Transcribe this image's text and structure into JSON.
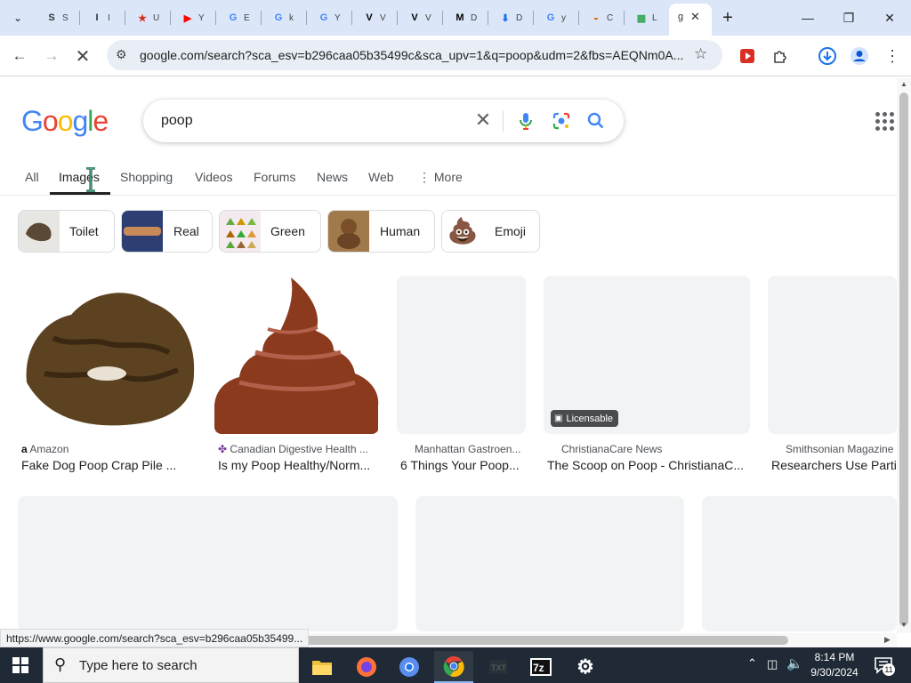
{
  "browser": {
    "tabs": [
      {
        "icon": "S",
        "title": "S",
        "color": "#333333"
      },
      {
        "icon": "I",
        "title": "I",
        "color": "#333333"
      },
      {
        "icon": "★",
        "title": "U",
        "color": "#d93025"
      },
      {
        "icon": "▶",
        "title": "Y",
        "color": "#ff0000"
      },
      {
        "icon": "G",
        "title": "E",
        "color": "#4285f4"
      },
      {
        "icon": "G",
        "title": "k",
        "color": "#4285f4"
      },
      {
        "icon": "G",
        "title": "Y",
        "color": "#4285f4"
      },
      {
        "icon": "V",
        "title": "V",
        "color": "#000000"
      },
      {
        "icon": "V",
        "title": "V",
        "color": "#000000"
      },
      {
        "icon": "M",
        "title": "D",
        "color": "#000000"
      },
      {
        "icon": "⬇",
        "title": "D",
        "color": "#1a73e8"
      },
      {
        "icon": "G",
        "title": "y",
        "color": "#4285f4"
      },
      {
        "icon": "◒",
        "title": "C",
        "color": "#e8710a"
      },
      {
        "icon": "▦",
        "title": "L",
        "color": "#34a853"
      }
    ],
    "active_tab": {
      "title": "g",
      "close": "✕"
    },
    "new_tab": "+",
    "window": {
      "minimize": "—",
      "maximize": "❐",
      "close": "✕"
    },
    "url": "google.com/search?sca_esv=b296caa05b35499c&sca_upv=1&q=poop&udm=2&fbs=AEQNm0A...",
    "status_url": "https://www.google.com/search?sca_esv=b296caa05b35499..."
  },
  "google": {
    "logo": [
      "G",
      "o",
      "o",
      "g",
      "l",
      "e"
    ],
    "logo_colors": [
      "#4285f4",
      "#ea4335",
      "#fbbc05",
      "#4285f4",
      "#34a853",
      "#ea4335"
    ],
    "query": "poop",
    "clear": "✕",
    "tabs": [
      "All",
      "Images",
      "Shopping",
      "Videos",
      "Forums",
      "News",
      "Web",
      "More"
    ],
    "active_tab": "Images",
    "chips": [
      "Toilet",
      "Real",
      "Green",
      "Human",
      "Emoji"
    ],
    "chip_emoji": "💩",
    "results": [
      {
        "source": "Amazon",
        "title": "Fake Dog Poop Crap Pile ...",
        "favicon": "a"
      },
      {
        "source": "Canadian Digestive Health ...",
        "title": "Is my Poop Healthy/Norm...",
        "favicon": "✤"
      },
      {
        "source": "Manhattan Gastroen...",
        "title": "6 Things Your Poop..."
      },
      {
        "source": "ChristianaCare News",
        "title": "The Scoop on Poop - ChristianaC...",
        "badge": "Licensable"
      },
      {
        "source": "Smithsonian Magazine",
        "title": "Researchers Use Parti"
      }
    ]
  },
  "taskbar": {
    "search_placeholder": "Type here to search",
    "time": "8:14 PM",
    "date": "9/30/2024",
    "notification_count": "11",
    "apps": [
      "file-explorer",
      "firefox",
      "chrome-blue",
      "chrome",
      "text-editor",
      "7zip",
      "settings"
    ]
  }
}
